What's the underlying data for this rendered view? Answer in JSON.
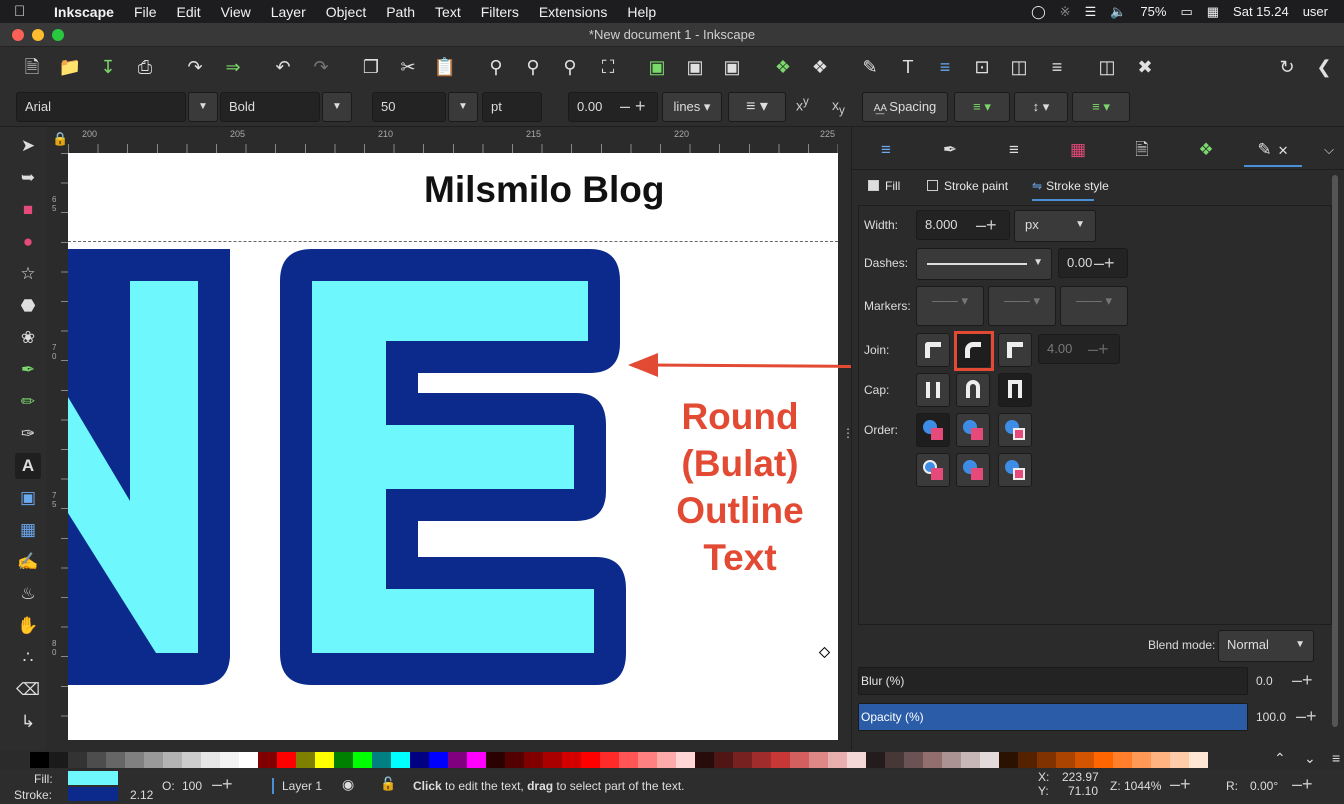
{
  "menubar": {
    "app": "Inkscape",
    "items": [
      "File",
      "Edit",
      "View",
      "Layer",
      "Object",
      "Path",
      "Text",
      "Filters",
      "Extensions",
      "Help"
    ],
    "battery": "75%",
    "clock": "Sat 15.24",
    "user": "user"
  },
  "window": {
    "title": "*New document 1 - Inkscape"
  },
  "textbar": {
    "font_family": "Arial",
    "font_style": "Bold",
    "font_size": "50",
    "unit": "pt",
    "spacing_value": "0.00",
    "line_mode": "lines",
    "spacing_label": "Spacing"
  },
  "ruler": {
    "h_ticks": [
      "200",
      "205",
      "210",
      "215",
      "220",
      "225"
    ],
    "v_ticks": [
      "6 5",
      "7 0",
      "7 5",
      "8 0"
    ]
  },
  "canvas": {
    "heading": "Milsmilo Blog",
    "annotation": [
      "Round",
      "(Bulat)",
      "Outline",
      "Text"
    ],
    "colors": {
      "fill": "#6ef8fd",
      "stroke": "#0b2a8c",
      "annotation": "#e24a33"
    }
  },
  "dock": {
    "subtabs": [
      "Fill",
      "Stroke paint",
      "Stroke style"
    ],
    "width_label": "Width:",
    "width_value": "8.000",
    "width_unit": "px",
    "dashes_label": "Dashes:",
    "dash_offset": "0.00",
    "markers_label": "Markers:",
    "join_label": "Join:",
    "miter_value": "4.00",
    "cap_label": "Cap:",
    "order_label": "Order:",
    "blend_label": "Blend mode:",
    "blend_value": "Normal",
    "blur_label": "Blur (%)",
    "blur_value": "0.0",
    "opacity_label": "Opacity (%)",
    "opacity_value": "100.0",
    "opacity_fill": 1.0
  },
  "status": {
    "fill_label": "Fill:",
    "stroke_label": "Stroke:",
    "stroke_width": "2.12",
    "opacity_label": "O:",
    "opacity_value": "100",
    "layer": "Layer 1",
    "hint_bold1": "Click",
    "hint_1": " to edit the text, ",
    "hint_bold2": "drag",
    "hint_2": " to select part of the text.",
    "x_label": "X:",
    "x_value": "223.97",
    "y_label": "Y:",
    "y_value": "71.10",
    "zoom_label": "Z:",
    "zoom_value": "1044%",
    "rot_label": "R:",
    "rot_value": "0.00°"
  }
}
